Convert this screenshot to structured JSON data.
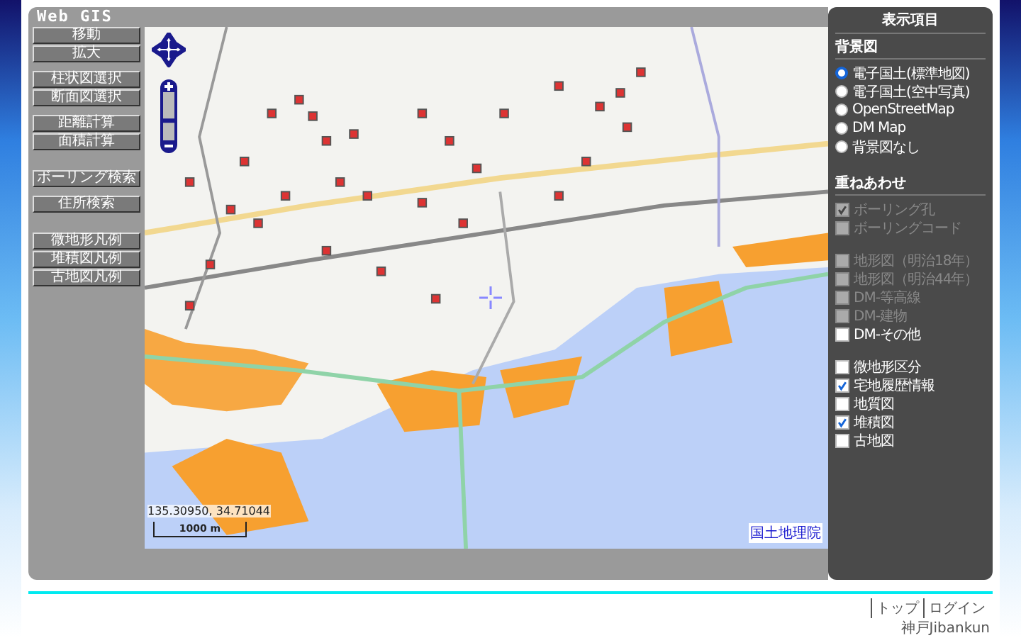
{
  "title": "Web GIS",
  "tool_groups": [
    [
      "移動",
      "拡大"
    ],
    [
      "柱状図選択",
      "断面図選択"
    ],
    [
      "距離計算",
      "面積計算"
    ],
    [
      "ボーリング検索"
    ],
    [
      "住所検索"
    ],
    [
      "微地形凡例",
      "堆積図凡例",
      "古地図凡例"
    ]
  ],
  "map": {
    "zoom": {
      "level": 0.4
    },
    "coordinates": "135.30950, 34.71044",
    "scale": "1000 m",
    "attribution": "国土地理院"
  },
  "panel": {
    "title": "表示項目",
    "background": {
      "title": "背景図",
      "items": [
        {
          "label": "電子国土(標準地図)",
          "selected": true
        },
        {
          "label": "電子国土(空中写真)",
          "selected": false
        },
        {
          "label": "OpenStreetMap",
          "selected": false
        },
        {
          "label": "DM Map",
          "selected": false
        },
        {
          "label": "背景図なし",
          "selected": false
        }
      ]
    },
    "overlay": {
      "title": "重ねあわせ",
      "groups": [
        [
          {
            "label": "ボーリング孔",
            "checked": true,
            "disabled": true
          },
          {
            "label": "ボーリングコード",
            "checked": false,
            "disabled": true
          }
        ],
        [
          {
            "label": "地形図（明治18年）",
            "checked": false,
            "disabled": true
          },
          {
            "label": "地形図（明治44年）",
            "checked": false,
            "disabled": true
          },
          {
            "label": "DM-等高線",
            "checked": false,
            "disabled": true
          },
          {
            "label": "DM-建物",
            "checked": false,
            "disabled": true
          },
          {
            "label": "DM-その他",
            "checked": false,
            "disabled": false
          }
        ],
        [
          {
            "label": "微地形区分",
            "checked": false,
            "disabled": false
          },
          {
            "label": "宅地履歴情報",
            "checked": true,
            "disabled": false
          },
          {
            "label": "地質図",
            "checked": false,
            "disabled": false
          },
          {
            "label": "堆積図",
            "checked": true,
            "disabled": false
          },
          {
            "label": "古地図",
            "checked": false,
            "disabled": false
          }
        ]
      ]
    }
  },
  "footer": {
    "links": [
      "トップ",
      "ログイン"
    ],
    "site": "神戸Jibankun"
  }
}
